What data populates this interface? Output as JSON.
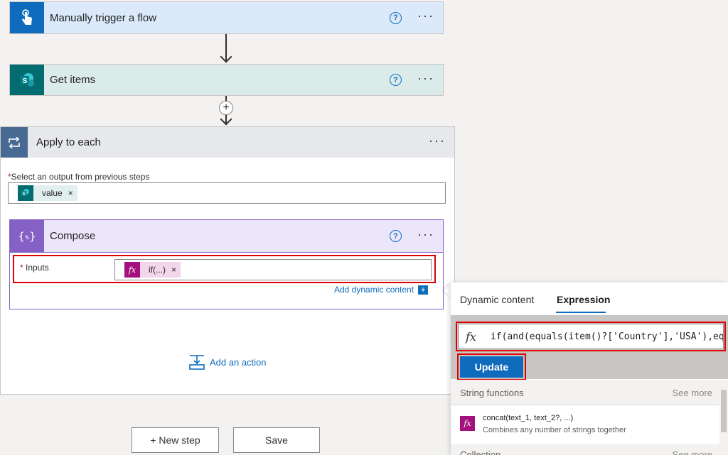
{
  "trigger": {
    "title": "Manually trigger a flow",
    "color": "#0f6cbd",
    "icon": "touch-hand-icon"
  },
  "get_items": {
    "title": "Get items",
    "color": "#036c70",
    "icon": "sharepoint-icon"
  },
  "apply_each": {
    "title": "Apply to each",
    "select_label": "Select an output from previous steps",
    "token_label": "value",
    "icon": "loop-icon"
  },
  "compose": {
    "title": "Compose",
    "inputs_label": "Inputs",
    "token_label": "if(...)",
    "add_dynamic": "Add dynamic content",
    "icon": "compose-icon"
  },
  "add_action": "Add an action",
  "new_step": "+ New step",
  "save": "Save",
  "help_glyph": "?",
  "more_glyph": "···",
  "required_mark": "*",
  "remove_glyph": "×",
  "fx_glyph": "fx",
  "plus_glyph": "+",
  "dyn_plus_glyph": "+",
  "panel": {
    "tab_dynamic": "Dynamic content",
    "tab_expression": "Expression",
    "expression_value": "if(and(equals(item()?['Country'],'USA'),eq",
    "update_label": "Update",
    "section_title": "String functions",
    "see_more": "See more",
    "fn_name": "concat(text_1, text_2?, ...)",
    "fn_desc": "Combines any number of strings together",
    "section2_title": "Collection",
    "see_more2": "See more"
  },
  "colors": {
    "trigger_bg": "#dbe9fb",
    "get_items_bg": "#dbebea",
    "apply_bg": "#e6e8ec",
    "compose_bg": "#ece6fb",
    "compose_accent": "#8661c5",
    "fx_color": "#a4117d",
    "update_blue": "#0f6cbd"
  }
}
